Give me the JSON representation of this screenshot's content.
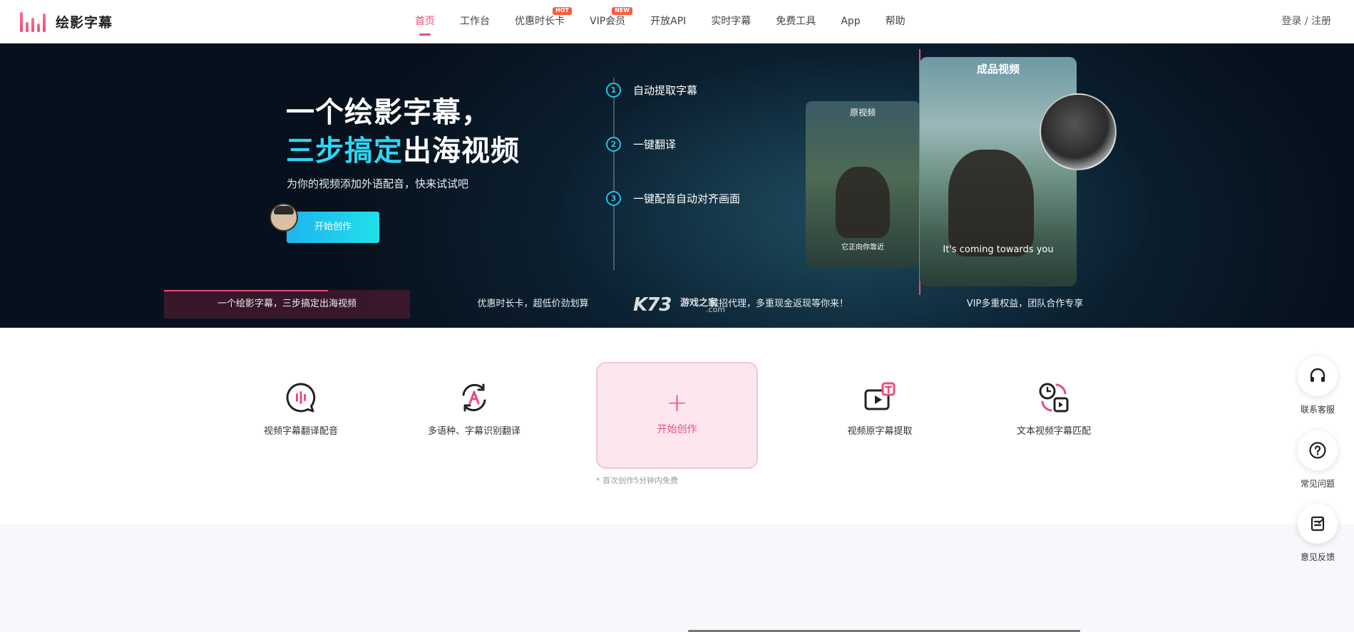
{
  "header": {
    "logo_text": "绘影字幕",
    "nav": [
      {
        "label": "首页",
        "active": true,
        "badge": ""
      },
      {
        "label": "工作台",
        "active": false,
        "badge": ""
      },
      {
        "label": "优惠时长卡",
        "active": false,
        "badge": "HOT"
      },
      {
        "label": "VIP会员",
        "active": false,
        "badge": "NEW"
      },
      {
        "label": "开放API",
        "active": false,
        "badge": ""
      },
      {
        "label": "实时字幕",
        "active": false,
        "badge": ""
      },
      {
        "label": "免费工具",
        "active": false,
        "badge": ""
      },
      {
        "label": "App",
        "active": false,
        "badge": ""
      },
      {
        "label": "帮助",
        "active": false,
        "badge": ""
      }
    ],
    "login_label": "登录 / 注册"
  },
  "hero": {
    "title_line1": "一个绘影字幕，",
    "title_line2_accent": "三步搞定",
    "title_line2_rest": "出海视频",
    "subtitle": "为你的视频添加外语配音，快来试试吧",
    "cta_label": "开始创作",
    "steps": [
      {
        "num": "1",
        "text": "自动提取字幕"
      },
      {
        "num": "2",
        "text": "一键翻译"
      },
      {
        "num": "3",
        "text": "一键配音自动对齐画面"
      }
    ],
    "card_original": {
      "label": "原视频",
      "caption": "它正向你靠近"
    },
    "card_final": {
      "label": "成品视频",
      "caption": "It's coming towards you"
    },
    "tabs": [
      {
        "label": "一个绘影字幕，三步搞定出海视频",
        "active": true
      },
      {
        "label": "优惠时长卡，超低价劲划算",
        "active": false
      },
      {
        "label": "诚招代理，多重现金返现等你来！",
        "active": false
      },
      {
        "label": "VIP多重权益，团队合作专享",
        "active": false
      }
    ],
    "watermark": {
      "main": "K73",
      "sub": "游戏之家",
      "domain": ".com"
    }
  },
  "features": {
    "items": [
      {
        "label": "视频字幕翻译配音",
        "icon": "voice-bubble-icon"
      },
      {
        "label": "多语种、字幕识别翻译",
        "icon": "translate-icon"
      },
      {
        "label": "视频原字幕提取",
        "icon": "subtitle-extract-icon"
      },
      {
        "label": "文本视频字幕匹配",
        "icon": "subtitle-match-icon"
      }
    ],
    "create": {
      "label": "开始创作",
      "note": "* 首次创作5分钟内免费"
    }
  },
  "side_buttons": [
    {
      "label": "联系客服",
      "icon": "headset-icon"
    },
    {
      "label": "常见问题",
      "icon": "question-icon"
    },
    {
      "label": "意见反馈",
      "icon": "feedback-icon"
    }
  ],
  "colors": {
    "accent": "#e84e77",
    "cyan": "#2fd5f0",
    "hero_bg": "#07111d"
  }
}
